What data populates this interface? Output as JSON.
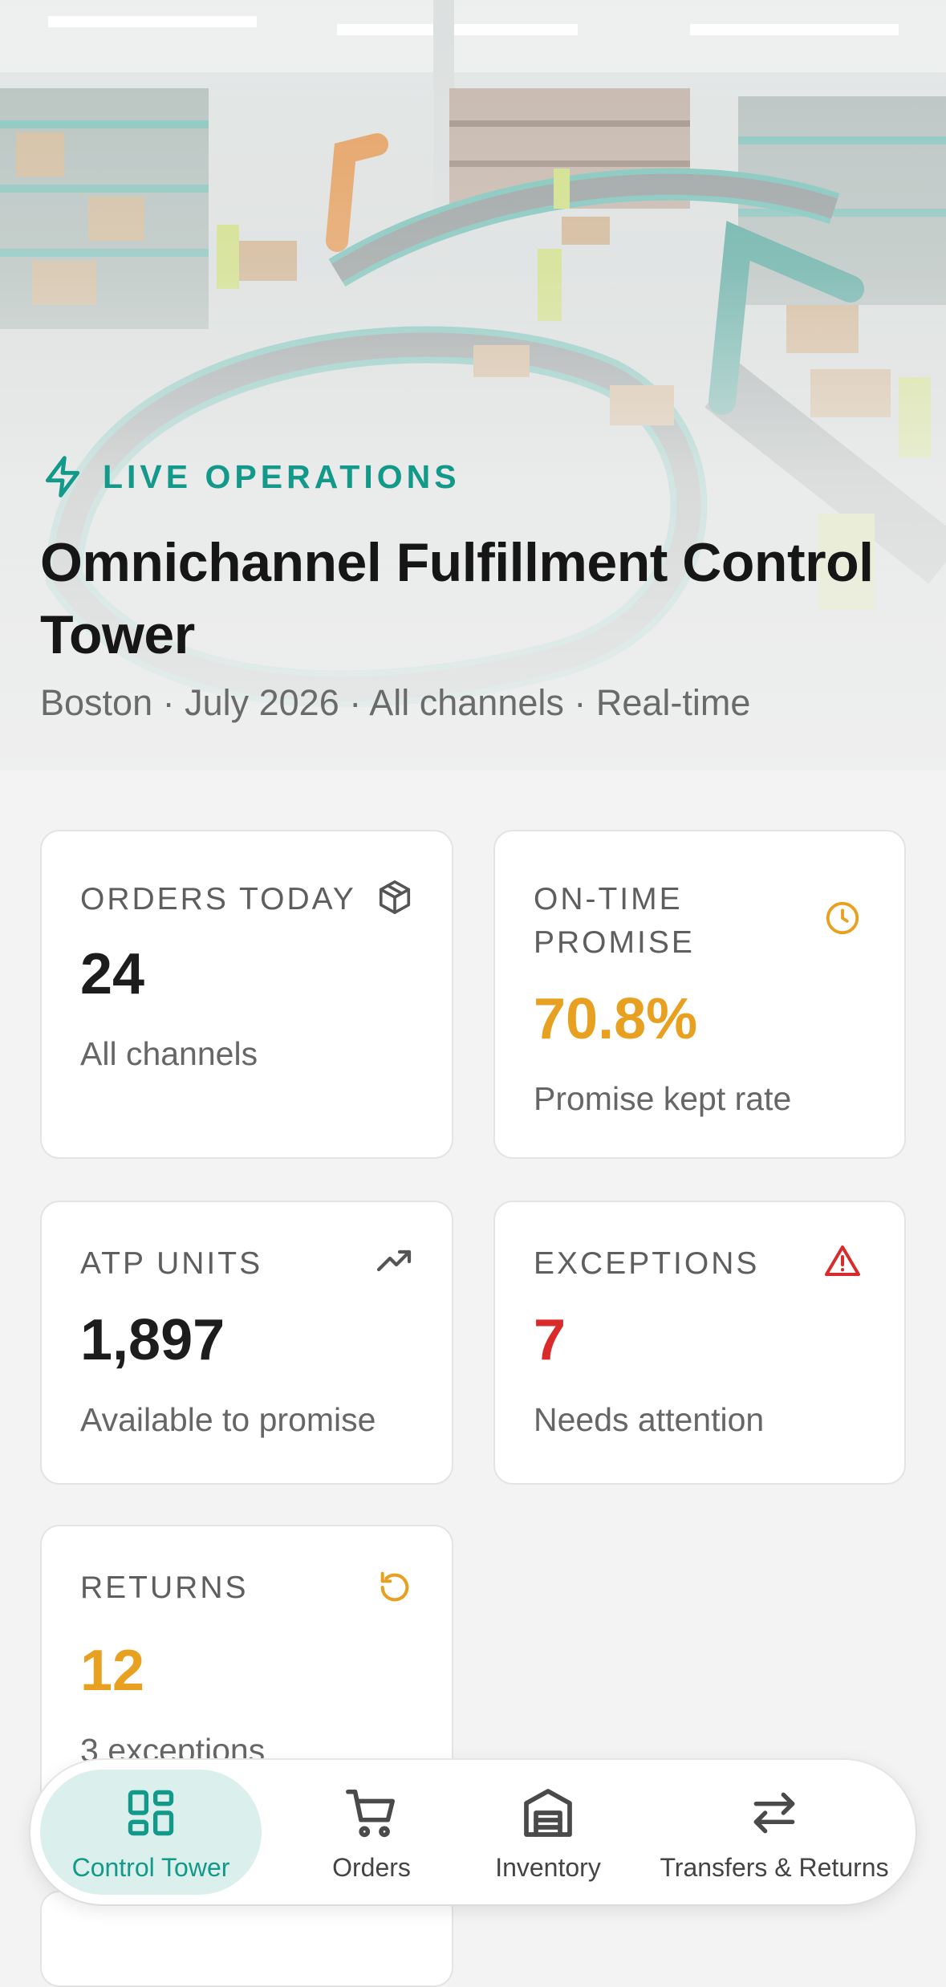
{
  "hero": {
    "kicker": "LIVE OPERATIONS",
    "title": "Omnichannel Fulfillment Control Tower",
    "subtitle": "Boston · July 2026 · All channels · Real-time",
    "kicker_icon": "lightning-bolt-icon",
    "accent_color": "#13998a"
  },
  "kpis": [
    {
      "label": "ORDERS TODAY",
      "value": "24",
      "sub": "All channels",
      "icon": "package-box-icon",
      "value_color": "#1d1d1d"
    },
    {
      "label": "ON-TIME PROMISE",
      "value": "70.8%",
      "sub": "Promise kept rate",
      "icon": "clock-icon",
      "value_color": "#e8a020"
    },
    {
      "label": "ATP UNITS",
      "value": "1,897",
      "sub": "Available to promise",
      "icon": "trending-up-icon",
      "value_color": "#1d1d1d"
    },
    {
      "label": "EXCEPTIONS",
      "value": "7",
      "sub": "Needs attention",
      "icon": "warning-triangle-icon",
      "value_color": "#d92b2b"
    },
    {
      "label": "RETURNS",
      "value": "12",
      "sub": "3 exceptions",
      "icon": "rotate-ccw-icon",
      "value_color": "#e8a020"
    }
  ],
  "nav": {
    "items": [
      {
        "label": "Control Tower",
        "icon": "grid-layout-icon",
        "active": true
      },
      {
        "label": "Orders",
        "icon": "shopping-cart-icon",
        "active": false
      },
      {
        "label": "Inventory",
        "icon": "warehouse-icon",
        "active": false
      },
      {
        "label": "Transfers & Returns",
        "icon": "swap-arrows-icon",
        "active": false
      }
    ]
  },
  "colors": {
    "teal": "#13998a",
    "amber": "#e8a020",
    "red": "#d92b2b",
    "text": "#1d1d1d",
    "muted": "#666666",
    "background": "#f3f3f3"
  }
}
